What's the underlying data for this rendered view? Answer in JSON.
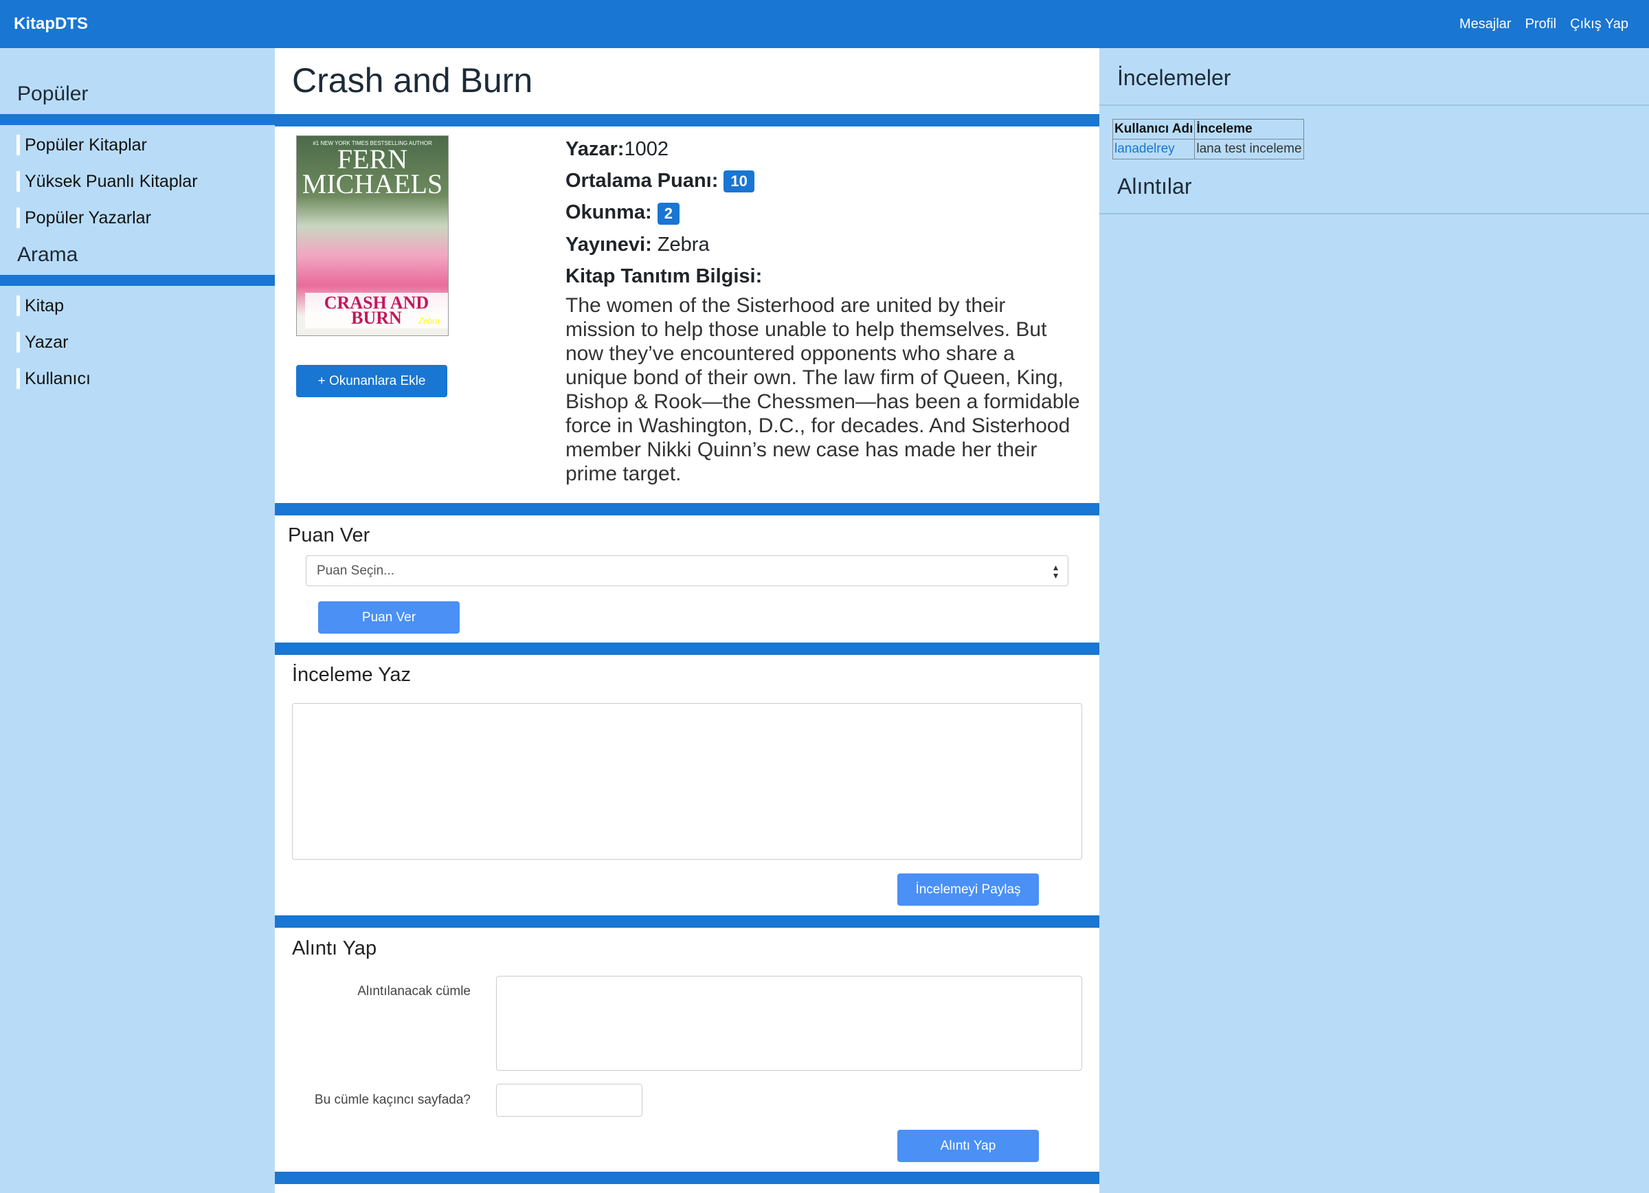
{
  "navbar": {
    "brand": "KitapDTS",
    "links": [
      "Mesajlar",
      "Profil",
      "Çıkış Yap"
    ]
  },
  "sidebar": {
    "popular_title": "Popüler",
    "popular_items": [
      "Popüler Kitaplar",
      "Yüksek Puanlı Kitaplar",
      "Popüler Yazarlar"
    ],
    "search_title": "Arama",
    "search_items": [
      "Kitap",
      "Yazar",
      "Kullanıcı"
    ]
  },
  "book": {
    "title": "Crash and Burn",
    "cover": {
      "tagline": "#1 NEW YORK TIMES BESTSELLING AUTHOR",
      "author_text": "FERN MICHAELS",
      "title_text": "CRASH AND BURN",
      "publisher_mark": "Zebra"
    },
    "add_button": "+ Okunanlara Ekle",
    "author_label": "Yazar:",
    "author_value": "1002",
    "rating_label": "Ortalama Puanı:",
    "rating_value": "10",
    "read_label": "Okunma:",
    "read_value": "2",
    "publisher_label": "Yayınevi:",
    "publisher_value": "Zebra",
    "description_label": "Kitap Tanıtım Bilgisi:",
    "description": "The women of the Sisterhood are united by their mission to help those unable to help themselves. But now they’ve encountered opponents who share a unique bond of their own. The law firm of Queen, King, Bishop & Rook—the Chessmen—has been a formidable force in Washington, D.C., for decades. And Sisterhood member Nikki Quinn’s new case has made her their prime target."
  },
  "rate": {
    "title": "Puan Ver",
    "placeholder": "Puan Seçin...",
    "button": "Puan Ver"
  },
  "review": {
    "title": "İnceleme Yaz",
    "button": "İncelemeyi Paylaş"
  },
  "quote": {
    "title": "Alıntı Yap",
    "sentence_label": "Alıntılanacak cümle",
    "page_label": "Bu cümle kaçıncı sayfada?",
    "button": "Alıntı Yap"
  },
  "right_panel": {
    "reviews_title": "İncelemeler",
    "table_headers": [
      "Kullanıcı Adı",
      "İnceleme"
    ],
    "table_rows": [
      {
        "user": "lanadelrey",
        "review": "lana test inceleme"
      }
    ],
    "quotes_title": "Alıntılar"
  },
  "colors": {
    "navbar": "#1976d2",
    "background": "#b8dcf7",
    "badge": "#1976d2",
    "button": "#4a90f5"
  }
}
